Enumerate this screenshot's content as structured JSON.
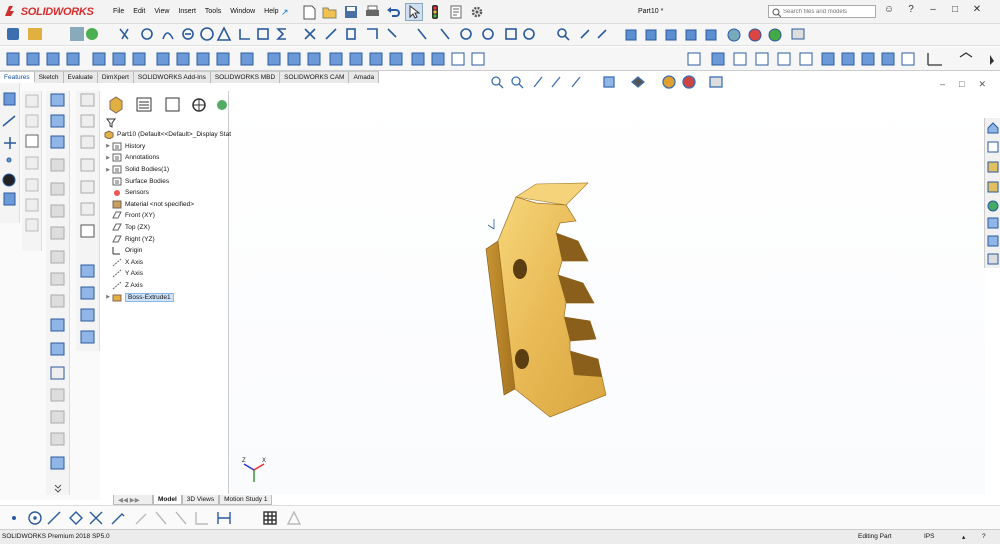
{
  "app": {
    "brand": "SOLIDWORKS",
    "document_title": "Part10 *"
  },
  "menu": [
    "File",
    "Edit",
    "View",
    "Insert",
    "Tools",
    "Window",
    "Help"
  ],
  "search": {
    "placeholder": "Search files and models"
  },
  "tabs": [
    "Features",
    "Sketch",
    "Evaluate",
    "DimXpert",
    "SOLIDWORKS Add-Ins",
    "SOLIDWORKS MBD",
    "SOLIDWORKS CAM",
    "Amada"
  ],
  "active_tab": "Features",
  "feature_tree": {
    "root": "Part10  (Default<<Default>_Display State",
    "items": [
      {
        "label": "History",
        "expandable": true
      },
      {
        "label": "Annotations",
        "expandable": true
      },
      {
        "label": "Solid Bodies(1)",
        "expandable": true
      },
      {
        "label": "Surface Bodies",
        "expandable": false
      },
      {
        "label": "Sensors",
        "expandable": false
      },
      {
        "label": "Material <not specified>",
        "expandable": false
      },
      {
        "label": "Front (XY)",
        "expandable": false
      },
      {
        "label": "Top (ZX)",
        "expandable": false
      },
      {
        "label": "Right (YZ)",
        "expandable": false
      },
      {
        "label": "Origin",
        "expandable": false
      },
      {
        "label": "X Axis",
        "expandable": false
      },
      {
        "label": "Y Axis",
        "expandable": false
      },
      {
        "label": "Z Axis",
        "expandable": false
      },
      {
        "label": "Boss-Extrude1",
        "expandable": true,
        "selected": true
      }
    ]
  },
  "view_tabs": [
    "Model",
    "3D Views",
    "Motion Study 1"
  ],
  "active_view_tab": "Model",
  "status": {
    "version": "SOLIDWORKS Premium 2018 SP5.0",
    "mode": "Editing Part",
    "units": "IPS"
  },
  "triad": {
    "x": "X",
    "y": "Y",
    "z": "Z"
  },
  "colors": {
    "brand_red": "#d32f2f",
    "part_gold": "#e2b04a",
    "selection_blue": "#cfe4fa"
  }
}
